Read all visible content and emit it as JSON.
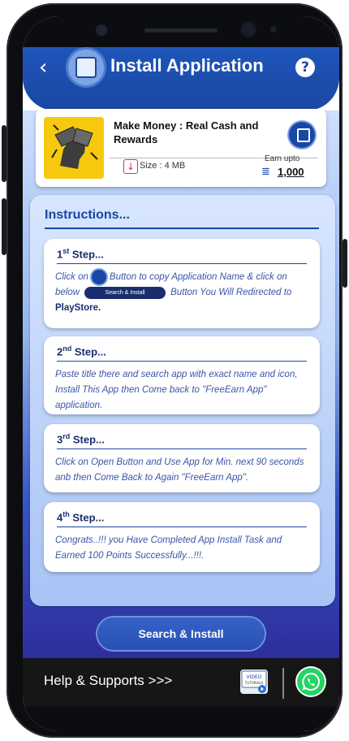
{
  "header": {
    "back_icon": "chevron-left-icon",
    "title_icon": "download-box-icon",
    "title": "Install Application",
    "help_icon": "question-circle-icon",
    "help_symbol": "?"
  },
  "app": {
    "name": "Make Money : Real Cash and Rewards",
    "copy_icon": "copy-icon",
    "size_icon": "download-icon",
    "size_text": "Size : 4 MB",
    "earn_label": "Earn upto",
    "earn_icon": "coin-stack-icon",
    "earn_value": "1,000"
  },
  "instructions": {
    "title": "Instructions...",
    "steps": [
      {
        "num": "1",
        "sup": "st",
        "label": "Step...",
        "text_parts": [
          "Click on",
          "Button to copy Application Name & click on below",
          "Button You Will Redirected to",
          "PlayStore."
        ],
        "inline_button": "Search & Install"
      },
      {
        "num": "2",
        "sup": "nd",
        "label": "Step...",
        "text": "Paste title there and search app with exact name and icon, Install This App then Come back to \"FreeEarn App\" application."
      },
      {
        "num": "3",
        "sup": "rd",
        "label": "Step...",
        "text": "Click on Open Button and Use App for Min. next 90 seconds anb then Come Back to Again \"FreeEarn App\"."
      },
      {
        "num": "4",
        "sup": "th",
        "label": "Step...",
        "text": "Congrats..!!! you Have Completed App Install Task and Earned 100 Points Successfully...!!!."
      }
    ]
  },
  "search_button": "Search & Install",
  "footer": {
    "help_text": "Help & Supports  >>>",
    "video_icon": "video-tutorial-icon",
    "whatsapp_icon": "whatsapp-icon"
  },
  "colors": {
    "primary": "#1a47a3",
    "accent_yellow": "#f6c90e",
    "whatsapp": "#25d366"
  }
}
